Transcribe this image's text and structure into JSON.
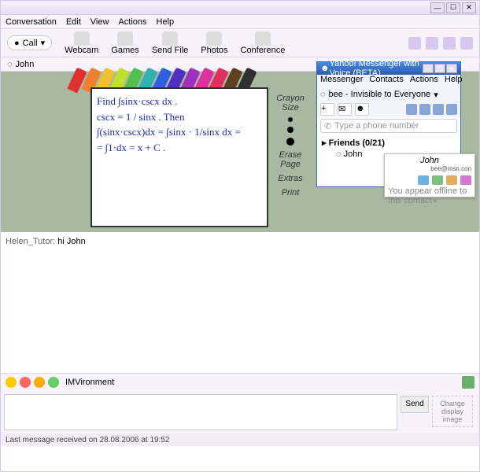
{
  "window": {
    "menus": [
      "Conversation",
      "Edit",
      "View",
      "Actions",
      "Help"
    ],
    "tools": {
      "call": "Call",
      "items": [
        "Webcam",
        "Games",
        "Send File",
        "Photos",
        "Conference"
      ]
    },
    "contact": "John"
  },
  "whiteboard": {
    "crayon_colors": [
      "#e03030",
      "#f08030",
      "#f0c030",
      "#c0e030",
      "#50c050",
      "#30b0b0",
      "#3060e0",
      "#5030c0",
      "#a030c0",
      "#e030a0",
      "#e03060",
      "#604020",
      "#303030"
    ],
    "math_lines": [
      "Find  ∫sinx·cscx dx .",
      "cscx = 1 / sinx .   Then",
      "∫(sinx·cscx)dx = ∫sinx · 1/sinx dx =",
      "= ∫1·dx = x + C ."
    ],
    "tools": {
      "crayon_size": "Crayon Size",
      "erase": "Erase Page",
      "extras": "Extras",
      "print": "Print"
    }
  },
  "chat": {
    "author": "Helen_Tutor:",
    "message": "hi John"
  },
  "bottom": {
    "imv_label": "IMVironment",
    "send": "Send",
    "change_img": "Change display image"
  },
  "status": "Last message received on 28.08.2006 at 19:52",
  "messenger": {
    "title": "Yahoo! Messenger with Voice (BETA)",
    "menus": [
      "Messenger",
      "Contacts",
      "Actions",
      "Help"
    ],
    "user_status": "bee - Invisible to Everyone",
    "phone_placeholder": "Type a phone number",
    "friends_hdr": "Friends (0/21)",
    "friend_list": [
      "John"
    ]
  },
  "contact_pop": {
    "name": "John",
    "email": "bee@msn.con",
    "footer": "You appear offline to this contact"
  }
}
